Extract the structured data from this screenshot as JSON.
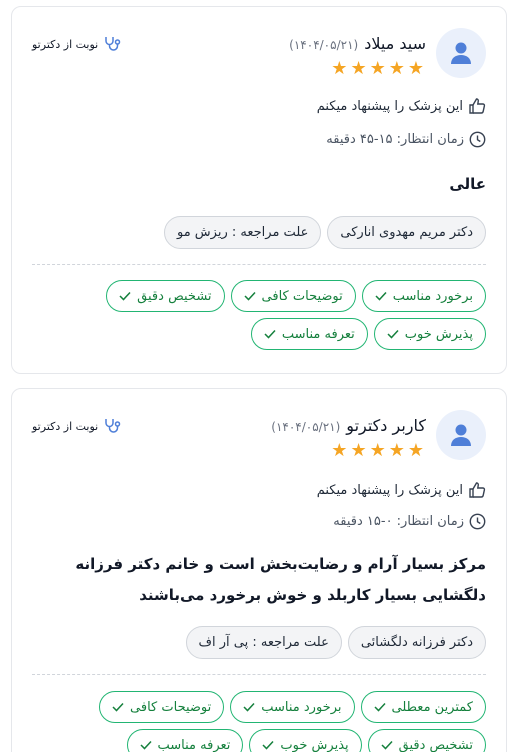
{
  "colors": {
    "star": "#f5a524",
    "tag_border": "#22b573",
    "tag_text": "#15803d",
    "avatar_bg": "#eaf0fb",
    "avatar_fg": "#4f7fd8"
  },
  "reviews": [
    {
      "name": "سید میلاد",
      "date": "(۱۴۰۴/۰۵/۲۱)",
      "rating": 5,
      "stars": [
        "★",
        "★",
        "★",
        "★",
        "★"
      ],
      "via": "نوبت از دکترتو",
      "recommend": "این پزشک را پیشنهاد میکنم",
      "wait": "زمان انتظار: ۱۵-۴۵ دقیقه",
      "comment": "عالی",
      "chips": [
        "دکتر مریم مهدوی انارکی",
        "علت مراجعه : ریزش مو"
      ],
      "tags": [
        "برخورد مناسب",
        "توضیحات کافی",
        "تشخیص دقیق",
        "پذیرش خوب",
        "تعرفه مناسب"
      ]
    },
    {
      "name": "کاربر دکترتو",
      "date": "(۱۴۰۴/۰۵/۲۱)",
      "rating": 5,
      "stars": [
        "★",
        "★",
        "★",
        "★",
        "★"
      ],
      "via": "نوبت از دکترتو",
      "recommend": "این پزشک را پیشنهاد میکنم",
      "wait": "زمان انتظار: ۰-۱۵ دقیقه",
      "comment": "مرکز بسیار آرام و رضایت‌بخش است و خانم دکتر فرزانه دلگشایی بسیار کاربلد و خوش برخورد می‌باشند",
      "chips": [
        "دکتر فرزانه دلگشائی",
        "علت مراجعه : پی آر اف"
      ],
      "tags": [
        "کمترین معطلی",
        "برخورد مناسب",
        "توضیحات کافی",
        "تشخیص دقیق",
        "پذیرش خوب",
        "تعرفه مناسب"
      ]
    }
  ]
}
